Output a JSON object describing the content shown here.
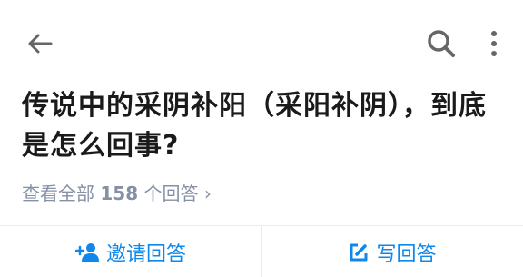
{
  "topbar": {
    "back_icon": "arrow-left-icon",
    "search_icon": "search-icon",
    "more_icon": "more-vertical-icon"
  },
  "question": {
    "title": "传说中的采阴补阳（采阳补阴），到底是怎么回事?"
  },
  "answers": {
    "prefix": "查看全部",
    "count": "158",
    "suffix": "个回答",
    "chevron": "›"
  },
  "actions": {
    "invite_label": "邀请回答",
    "invite_icon": "add-user-icon",
    "write_label": "写回答",
    "write_icon": "edit-icon"
  },
  "colors": {
    "accent": "#0f88eb",
    "muted": "#8590a6",
    "text": "#1a1a1a",
    "divider": "#ebebeb"
  }
}
